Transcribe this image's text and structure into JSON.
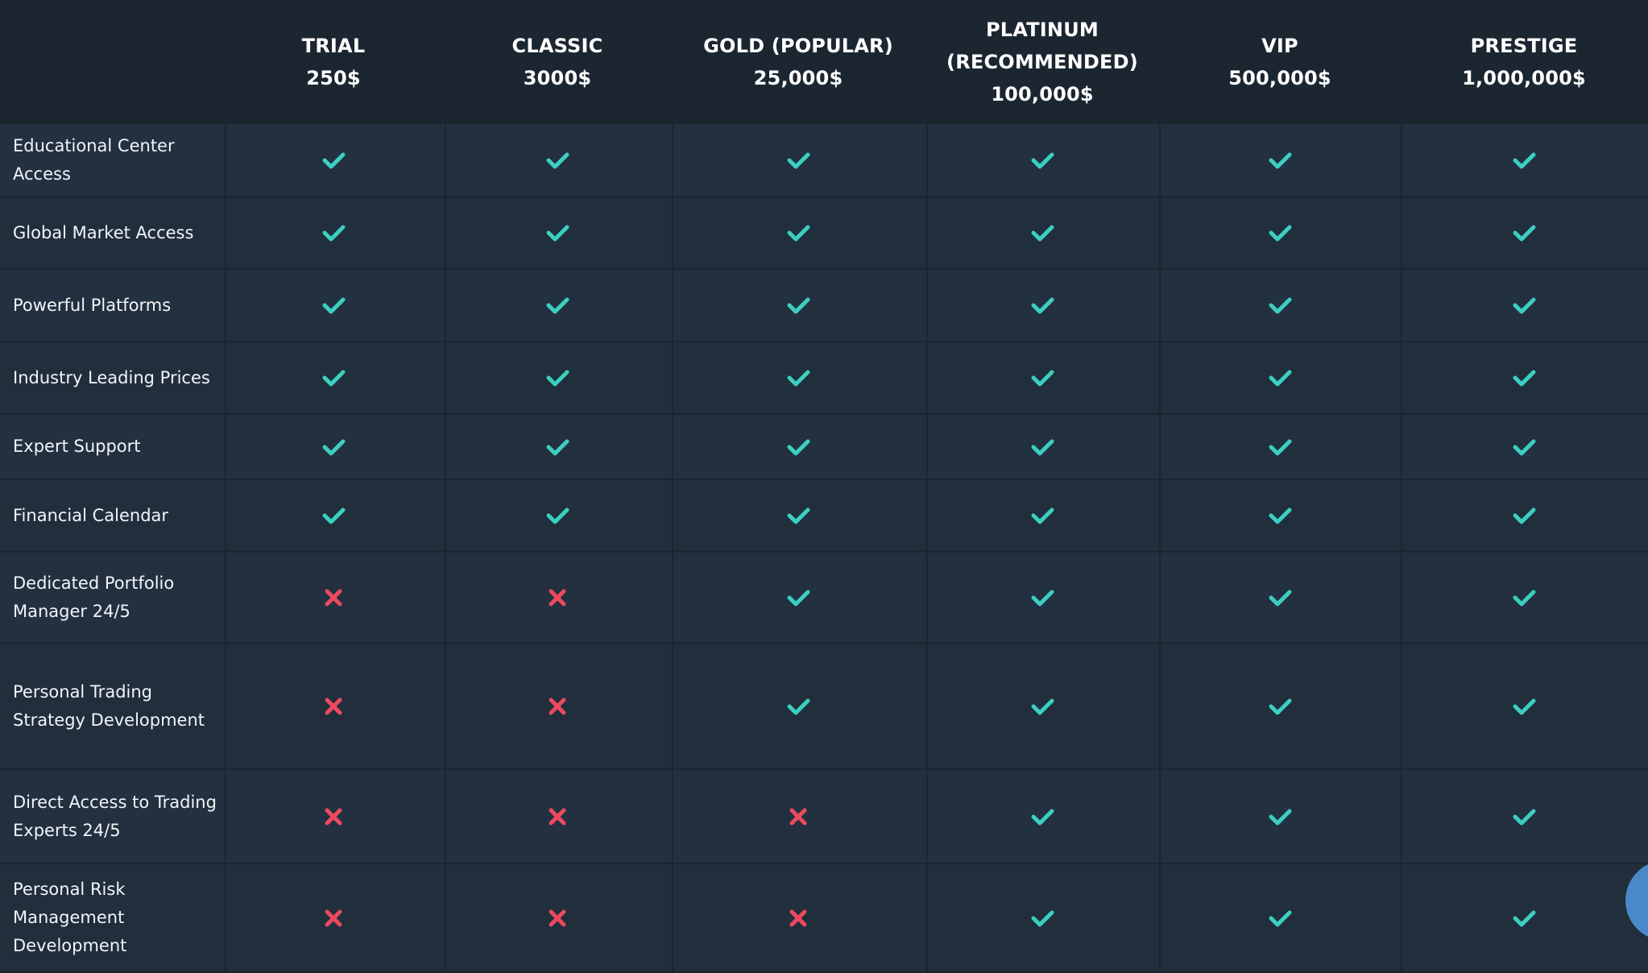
{
  "colors": {
    "check": "#3ccfc1",
    "cross": "#ec4a5f",
    "header_bg": "#1b2631",
    "row_bg": "#222f3d"
  },
  "plans": [
    {
      "name": "TRIAL",
      "price": "250$"
    },
    {
      "name": "CLASSIC",
      "price": "3000$"
    },
    {
      "name": "GOLD (POPULAR)",
      "price": "25,000$"
    },
    {
      "name": "PLATINUM\n(RECOMMENDED)",
      "price": "100,000$"
    },
    {
      "name": "VIP",
      "price": "500,000$"
    },
    {
      "name": "PRESTIGE",
      "price": "1,000,000$"
    }
  ],
  "features": [
    {
      "label": "Educational Center Access",
      "included": [
        true,
        true,
        true,
        true,
        true,
        true
      ]
    },
    {
      "label": "Global Market Access",
      "included": [
        true,
        true,
        true,
        true,
        true,
        true
      ]
    },
    {
      "label": "Powerful Platforms",
      "included": [
        true,
        true,
        true,
        true,
        true,
        true
      ]
    },
    {
      "label": "Industry Leading Prices",
      "included": [
        true,
        true,
        true,
        true,
        true,
        true
      ]
    },
    {
      "label": "Expert Support",
      "included": [
        true,
        true,
        true,
        true,
        true,
        true
      ]
    },
    {
      "label": "Financial Calendar",
      "included": [
        true,
        true,
        true,
        true,
        true,
        true
      ]
    },
    {
      "label": "Dedicated Portfolio Manager 24/5",
      "included": [
        false,
        false,
        true,
        true,
        true,
        true
      ]
    },
    {
      "label": "Personal Trading Strategy Development",
      "included": [
        false,
        false,
        true,
        true,
        true,
        true
      ]
    },
    {
      "label": "Direct Access to Trading Experts 24/5",
      "included": [
        false,
        false,
        false,
        true,
        true,
        true
      ]
    },
    {
      "label": "Personal Risk Management Development",
      "included": [
        false,
        false,
        false,
        true,
        true,
        true
      ]
    }
  ],
  "icons": {
    "included": "check-icon",
    "excluded": "cross-icon"
  }
}
